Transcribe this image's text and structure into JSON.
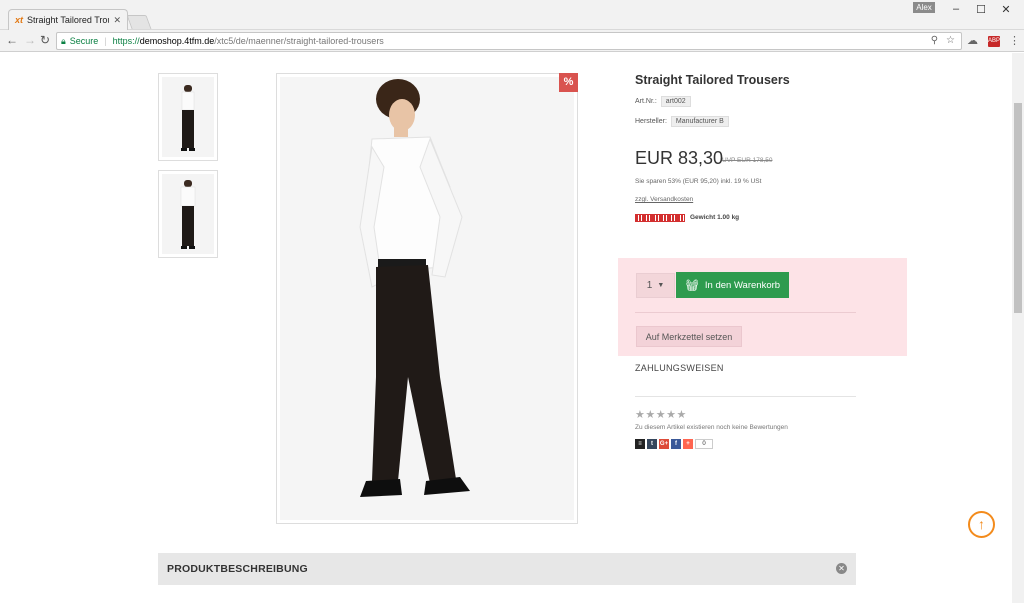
{
  "browser": {
    "tab_title": "Straight Tailored Trousers",
    "tab_favicon": "xt",
    "user_badge": "Alex",
    "secure_label": "Secure",
    "url_scheme": "https://",
    "url_host": "demoshop.4tfm.de",
    "url_path": "/xtc5/de/maenner/straight-tailored-trousers",
    "extension_badge": "ABP"
  },
  "product": {
    "title": "Straight Tailored Trousers",
    "art_nr_label": "Art.Nr.:",
    "art_nr": "art002",
    "manufacturer_label": "Hersteller:",
    "manufacturer": "Manufacturer B",
    "price": "EUR 83,30",
    "uvp": "UVP EUR 178,50",
    "savings": "Sie sparen 53% (EUR 95,20)   inkl. 19 % USt",
    "shipping_link": "zzgl. Versandkosten",
    "weight_label": "Gewicht",
    "weight_value": "1.00 kg",
    "sale_badge": "%"
  },
  "cart": {
    "quantity": "1",
    "add_to_cart_label": "In den Warenkorb",
    "wishlist_label": "Auf Merkzettel setzen"
  },
  "payments": {
    "label": "ZAHLUNGSWEISEN"
  },
  "reviews": {
    "stars": "★★★★★",
    "rating": 0,
    "no_reviews_text": "Zu diesem Artikel existieren noch keine Bewertungen"
  },
  "share": {
    "count": "0"
  },
  "description": {
    "title": "PRODUKTBESCHREIBUNG"
  },
  "colors": {
    "cart_button": "#2e9b4e",
    "cart_box": "#fde3e7",
    "sale_badge": "#d9534f",
    "to_top": "#f38b1c"
  }
}
